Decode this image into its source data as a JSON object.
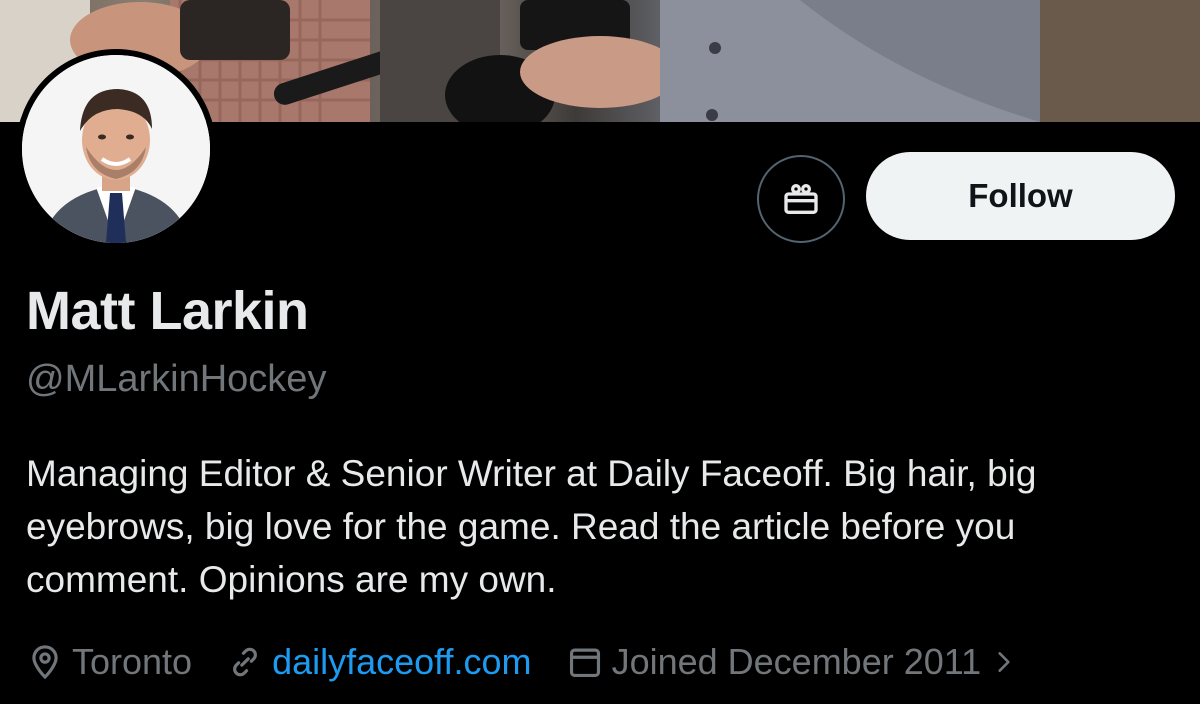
{
  "profile": {
    "name": "Matt Larkin",
    "handle": "@MLarkinHockey",
    "bio": "Managing Editor & Senior Writer at Daily Faceoff. Big hair, big eyebrows, big love for the game. Read the article before you comment. Opinions are my own.",
    "location": "Toronto",
    "website": "dailyfaceoff.com",
    "joined": "Joined December 2011"
  },
  "actions": {
    "follow_label": "Follow",
    "gift_icon": "gift-icon"
  },
  "icons": {
    "location": "map-pin-icon",
    "website": "link-icon",
    "joined": "calendar-icon",
    "more": "chevron-right-icon"
  },
  "colors": {
    "background": "#000000",
    "text_primary": "#e7e9ea",
    "text_secondary": "#71767b",
    "link": "#1d9bf0",
    "follow_bg": "#eff3f4"
  }
}
